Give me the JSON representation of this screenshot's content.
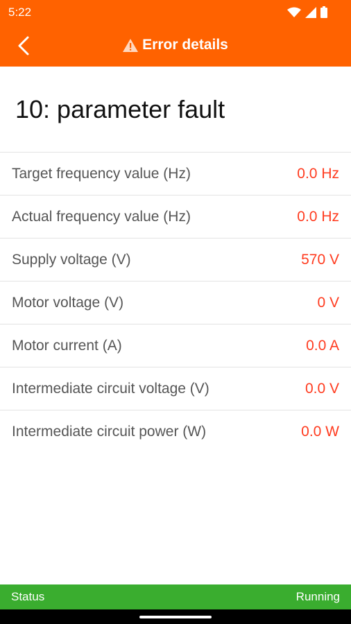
{
  "status_bar": {
    "time": "5:22"
  },
  "app_bar": {
    "title": "Error details"
  },
  "error": {
    "title": "10: parameter fault"
  },
  "details": [
    {
      "label": "Target frequency value (Hz)",
      "value": "0.0 Hz"
    },
    {
      "label": "Actual frequency value (Hz)",
      "value": "0.0 Hz"
    },
    {
      "label": "Supply voltage (V)",
      "value": "570 V"
    },
    {
      "label": "Motor voltage (V)",
      "value": "0 V"
    },
    {
      "label": "Motor current (A)",
      "value": "0.0 A"
    },
    {
      "label": "Intermediate circuit voltage (V)",
      "value": "0.0 V"
    },
    {
      "label": "Intermediate circuit power (W)",
      "value": "0.0 W"
    }
  ],
  "footer": {
    "label": "Status",
    "value": "Running"
  },
  "colors": {
    "accent": "#ff6200",
    "value": "#ff3b1f",
    "status_ok": "#3aad2f"
  },
  "icons": [
    "wifi-icon",
    "signal-icon",
    "battery-icon",
    "back-arrow-icon",
    "warning-icon"
  ]
}
